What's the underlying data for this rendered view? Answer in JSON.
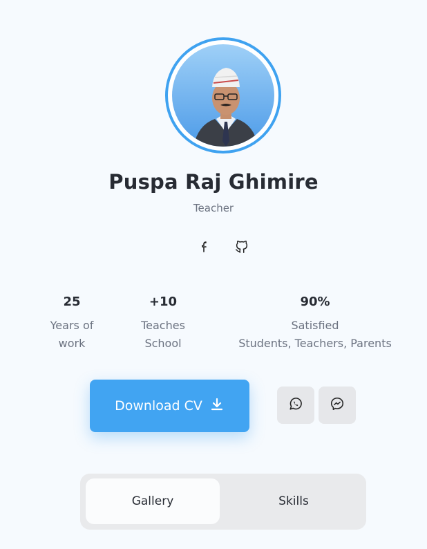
{
  "profile": {
    "name": "Puspa Raj Ghimire",
    "role": "Teacher"
  },
  "social": [
    {
      "icon": "facebook-icon"
    },
    {
      "icon": "github-icon"
    }
  ],
  "stats": [
    {
      "value": "25",
      "label": "Years of\nwork"
    },
    {
      "value": "+10",
      "label": "Teaches\nSchool"
    },
    {
      "value": "90%",
      "label": "Satisfied\nStudents, Teachers, Parents"
    }
  ],
  "actions": {
    "download_label": "Download CV",
    "download_icon": "download-icon",
    "whatsapp_icon": "whatsapp-icon",
    "messenger_icon": "messenger-icon"
  },
  "tabs": [
    {
      "label": "Gallery",
      "active": true
    },
    {
      "label": "Skills",
      "active": false
    }
  ],
  "colors": {
    "accent": "#41a4f2",
    "background": "#f6fafe",
    "text": "#272b33",
    "muted": "#6b7280"
  }
}
